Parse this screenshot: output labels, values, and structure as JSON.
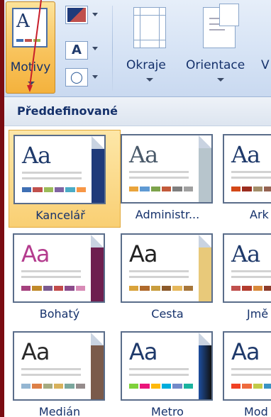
{
  "ribbon": {
    "motivy_label": "Motivy",
    "buttons": [
      {
        "label": "Okraje",
        "icon": "margins-icon"
      },
      {
        "label": "Orientace",
        "icon": "orientation-icon"
      },
      {
        "label": "V",
        "icon": "size-icon"
      }
    ],
    "small_icons": [
      {
        "name": "theme-colors-icon"
      },
      {
        "name": "theme-fonts-icon",
        "glyph": "A"
      },
      {
        "name": "theme-effects-icon",
        "glyph": "◯"
      }
    ]
  },
  "gallery": {
    "section_title": "Předdefinované",
    "themes": [
      {
        "label": "Kancelář",
        "glyph": "Aa",
        "text_color": "#1f3a6b",
        "side_color": "#1f3a7a",
        "swatches": [
          "#3f6fb3",
          "#c0504d",
          "#9bbb59",
          "#8064a2",
          "#4bacc6",
          "#f79646"
        ],
        "selected": true
      },
      {
        "label": "Administr...",
        "glyph": "Aa",
        "text_color": "#4a5a6a",
        "side_color": "#b7c5cc",
        "swatches": [
          "#e9a43b",
          "#5f9ad3",
          "#7da34b",
          "#c25a3a",
          "#7f7f7f",
          "#a0a0a0"
        ],
        "selected": false
      },
      {
        "label": "Ark",
        "glyph": "Aa",
        "text_color": "#1f3a6b",
        "side_color": "#333333",
        "swatches": [
          "#d34817",
          "#9b2d1f",
          "#a28e6a",
          "#956251",
          "#918485",
          "#855d5d"
        ],
        "selected": false
      },
      {
        "label": "Bohatý",
        "glyph": "Aa",
        "text_color": "#b43c8e",
        "side_color": "#6e1f4f",
        "swatches": [
          "#a5417e",
          "#c08a2a",
          "#7b5a8f",
          "#c24b4b",
          "#8b4b8b",
          "#d88bb6"
        ],
        "selected": false
      },
      {
        "label": "Cesta",
        "glyph": "Aa",
        "text_color": "#222222",
        "side_color": "#e8c97a",
        "swatches": [
          "#d9a33b",
          "#b06a2c",
          "#c99d3d",
          "#8c5a2a",
          "#e6b85c",
          "#a7763a"
        ],
        "selected": false
      },
      {
        "label": "Jmě",
        "glyph": "Aa",
        "text_color": "#1f3a6b",
        "side_color": "#7a2a2a",
        "swatches": [
          "#c0504d",
          "#b33c2e",
          "#d98a3a",
          "#8c3a2a",
          "#a05a3a",
          "#c07a4a"
        ],
        "selected": false
      },
      {
        "label": "Medián",
        "glyph": "Aa",
        "text_color": "#2a2a2a",
        "side_color": "#7a5a4a",
        "swatches": [
          "#94b6d2",
          "#dd8047",
          "#a5ab81",
          "#d8b25c",
          "#7ba79d",
          "#968c8c"
        ],
        "selected": false
      },
      {
        "label": "Metro",
        "glyph": "Aa",
        "text_color": "#1f3a6b",
        "side_color": "#111111",
        "swatches": [
          "#7fd13b",
          "#ea157a",
          "#feb80a",
          "#00addc",
          "#738ac8",
          "#1ab39f"
        ],
        "selected": false
      },
      {
        "label": "Mod",
        "glyph": "Aa",
        "text_color": "#1f3a6b",
        "side_color": "#c0504d",
        "swatches": [
          "#f14124",
          "#ee6a3d",
          "#c1ca49",
          "#3a93c3",
          "#a86bb4",
          "#c0504d"
        ],
        "selected": false
      }
    ]
  },
  "colors": {
    "accent_orange": "#f9cf73",
    "annotation_arrow": "#c81e2a",
    "ribbon_text": "#15316b"
  }
}
